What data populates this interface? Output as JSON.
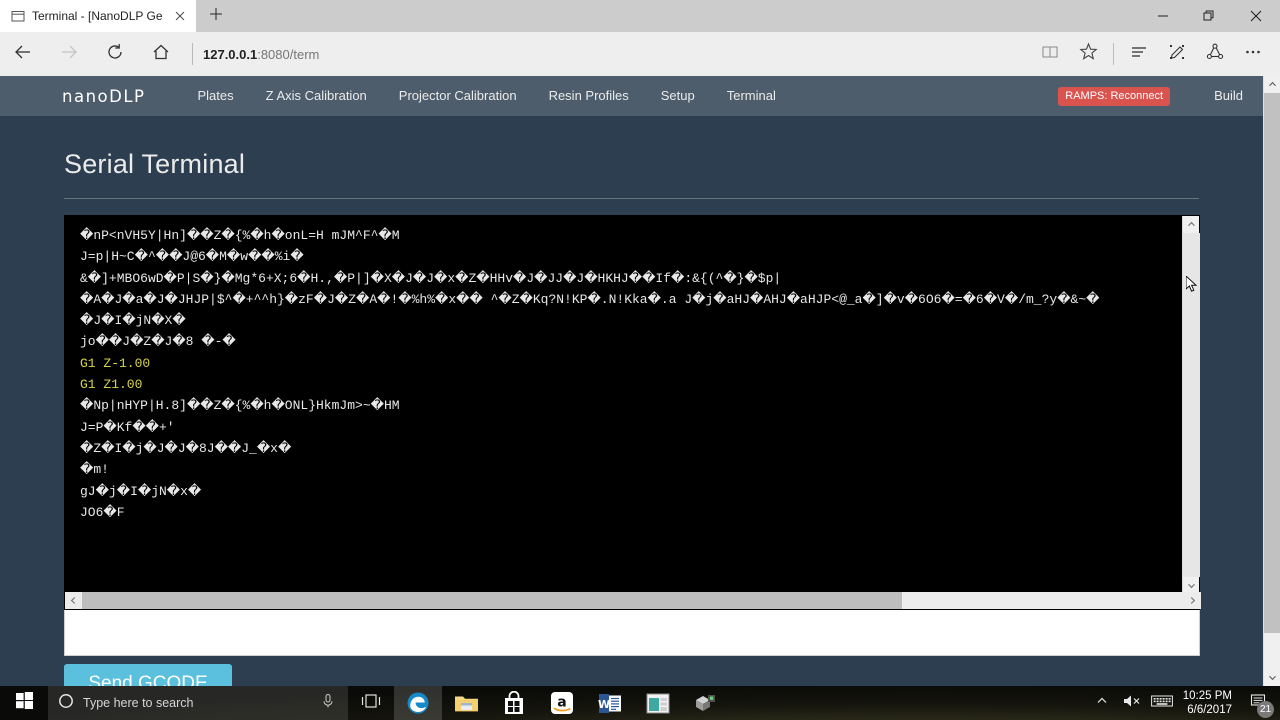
{
  "browser": {
    "tab": {
      "title": "Terminal - [NanoDLP Ge",
      "icon": "window-icon",
      "close_icon": "close-icon"
    },
    "newtab_icon": "plus-icon",
    "window_controls": {
      "minimize": "minimize-icon",
      "restore": "restore-icon",
      "close": "close-icon"
    },
    "nav": {
      "back": "back-arrow-icon",
      "forward": "forward-arrow-icon",
      "refresh": "refresh-icon",
      "home": "home-icon"
    },
    "address": {
      "host": "127.0.0.1",
      "rest": ":8080/term",
      "full": "127.0.0.1:8080/term"
    },
    "toolbar_icons": [
      "reading-view-icon",
      "favorites-star-icon",
      "hub-icon",
      "web-note-icon",
      "share-icon",
      "more-icon"
    ]
  },
  "navbar": {
    "brand": "nanoDLP",
    "links": [
      "Plates",
      "Z Axis Calibration",
      "Projector Calibration",
      "Resin Profiles",
      "Setup",
      "Terminal"
    ],
    "status_badge": "RAMPS: Reconnect",
    "build_link": "Build",
    "badge_color": "#d9534f",
    "bg_color": "#4e5d6c"
  },
  "page": {
    "title": "Serial Terminal",
    "background": "#2c3e50"
  },
  "terminal": {
    "background": "#000000",
    "text_color": "#e8e8e8",
    "gcode_color": "#d8d44a",
    "lines": [
      {
        "text": "�nP<nVH5Y|Hn]��Z�{%�h�onL=H mJM^F^�M",
        "type": "raw"
      },
      {
        "text": "J=p|H~C�^��J@6�M�w��%i�",
        "type": "raw"
      },
      {
        "text": "&�]+MBO6wD�P|S�}�Mg*6+X;6�H.,�P|]�X�J�J�x�Z�HHv�J�JJ�J�HKHJ��If�:&{(^�}�$p|",
        "type": "raw"
      },
      {
        "text": "�A�J�a�J�JHJP|$^�+^^h}�zF�J�Z�A�!�%h%�x�� ^�Z�Kq?N!KP�.N!Kka�.a J�j�aHJ�AHJ�aHJP<@_a�]�v�6O6�=�6�V�/m_?y�&~�",
        "type": "raw"
      },
      {
        "text": "�J�I�jN�X�",
        "type": "raw"
      },
      {
        "text": "jo��J�Z�J�8 �-�",
        "type": "raw"
      },
      {
        "text": "G1 Z-1.00",
        "type": "gcode"
      },
      {
        "text": "G1 Z1.00",
        "type": "gcode"
      },
      {
        "text": "�Np|nHYP|H.8]��Z�{%�h�ONL}HkmJm>~�HM",
        "type": "raw"
      },
      {
        "text": "J=P�Kf��+'",
        "type": "raw"
      },
      {
        "text": "�Z�I�j�J�J�8J��J_�x�",
        "type": "raw"
      },
      {
        "text": "�m!",
        "type": "raw"
      },
      {
        "text": "gJ�j�I�jN�x�",
        "type": "raw"
      },
      {
        "text": "JO6�F",
        "type": "raw"
      }
    ]
  },
  "form": {
    "gcode_value": "",
    "gcode_placeholder": "",
    "send_button": "Send GCODE",
    "send_button_color": "#5bc0de"
  },
  "taskbar": {
    "start_icon": "windows-start-icon",
    "search_placeholder": "Type here to search",
    "cortana_icon": "cortana-circle-icon",
    "mic_icon": "microphone-icon",
    "taskview_icon": "task-view-icon",
    "apps": [
      {
        "name": "edge",
        "label": "Microsoft Edge"
      },
      {
        "name": "file-explorer",
        "label": "File Explorer"
      },
      {
        "name": "store",
        "label": "Microsoft Store"
      },
      {
        "name": "amazon",
        "label": "Amazon"
      },
      {
        "name": "word",
        "label": "Microsoft Word"
      },
      {
        "name": "app-window",
        "label": "App"
      },
      {
        "name": "3d-builder",
        "label": "3D Builder"
      }
    ],
    "tray": {
      "chevron_icon": "show-hidden-icons-icon",
      "volume_icon": "volume-muted-icon",
      "keyboard_icon": "touch-keyboard-icon",
      "time": "10:25 PM",
      "date": "6/6/2017",
      "notification_icon": "action-center-icon",
      "notification_count": "21"
    }
  }
}
